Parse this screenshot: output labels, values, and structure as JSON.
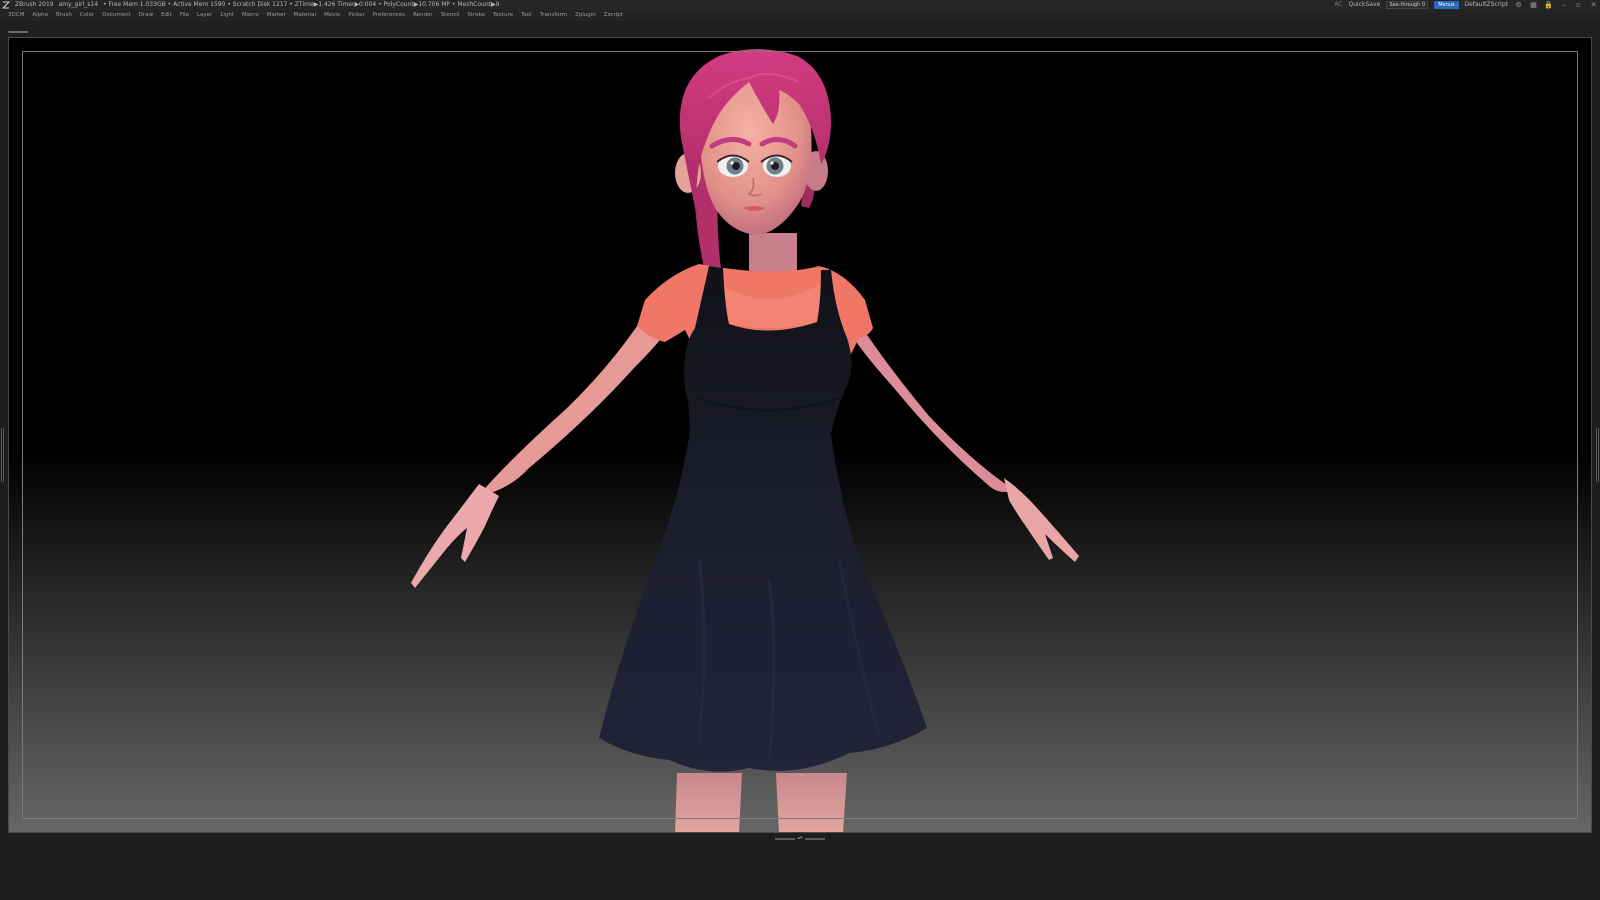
{
  "titlebar": {
    "app": "ZBrush 2019",
    "file": "amy_girl_s14",
    "stats": "• Free Mem 1.033GB • Active Mem 1590 • Scratch Disk 1217 • ZTime▶1.426 Timer▶0.004 • PolyCount▶10.706 MP • MeshCount▶9",
    "ac": "AC",
    "quicksave": "QuickSave",
    "see_through_label": "See-through",
    "see_through_value": "0",
    "menus_button": "Menus",
    "script": "DefaultZScript",
    "icons": [
      "layout-icon",
      "palette-icon",
      "lock-icon",
      "minimize-icon",
      "restore-icon",
      "close-icon"
    ]
  },
  "menubar": {
    "items": [
      "3DCM",
      "Alpha",
      "Brush",
      "Color",
      "Document",
      "Draw",
      "Edit",
      "File",
      "Layer",
      "Light",
      "Macro",
      "Marker",
      "Material",
      "Movie",
      "Picker",
      "Preferences",
      "Render",
      "Stencil",
      "Stroke",
      "Texture",
      "Tool",
      "Transform",
      "Zplugin",
      "Zscript"
    ]
  },
  "colors": {
    "accent": "#2c69b8",
    "see_through_fill": "#e0a234",
    "skin": "#e8a49a",
    "hair": "#c2326f",
    "shirt": "#f27a6a",
    "dress": "#1b1c2c",
    "eyes": "#6e7f8c"
  }
}
